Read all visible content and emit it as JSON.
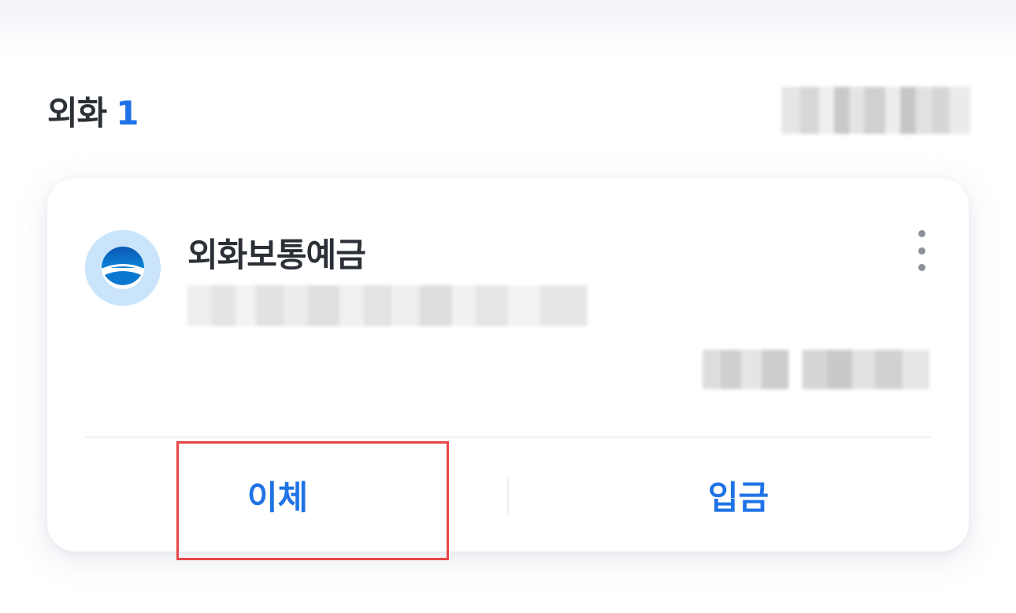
{
  "section": {
    "title": "외화",
    "count": "1"
  },
  "account": {
    "name": "외화보통예금"
  },
  "actions": {
    "transfer_label": "이체",
    "deposit_label": "입금"
  },
  "icons": {
    "logo": "bank-logo-icon",
    "menu": "more-vertical-icon"
  },
  "colors": {
    "accent": "#1f73e6",
    "highlight": "#e84646"
  }
}
